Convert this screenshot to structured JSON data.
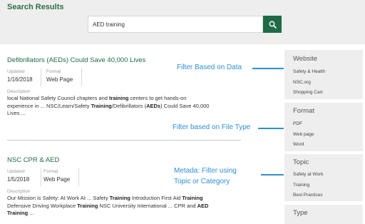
{
  "header": {
    "title": "Search Results",
    "search_value": "AED training"
  },
  "results": [
    {
      "title": "Defibrillators (AEDs) Could Save 40,000 Lives",
      "updated_label": "Updated",
      "updated_value": "1/16/2018",
      "format_label": "Format",
      "format_value": "Web Page",
      "description_label": "Description",
      "description_lines": [
        [
          "local National Safety Council chapters and ",
          {
            "b": "training"
          },
          " centers to get hands-on"
        ],
        [
          "experience in ... NSC/Learn/Safety ",
          {
            "b": "Training"
          },
          "/Defibrillators (",
          {
            "b": "AEDs"
          },
          ") Could Save 40,000"
        ],
        [
          "Lives ..."
        ]
      ]
    },
    {
      "title": "NSC CPR & AED",
      "updated_label": "Updated",
      "updated_value": "1/5/2018",
      "format_label": "Format",
      "format_value": "Web Page",
      "description_label": "Description",
      "description_lines": [
        [
          "Our Mission is Safety: At Work At ... Safety ",
          {
            "b": "Training"
          },
          " Introduction First Aid ",
          {
            "b": "Training"
          }
        ],
        [
          "Defensive Driving Workplace ",
          {
            "b": "Training"
          },
          " NSC University International ... CPR and ",
          {
            "b": "AED"
          }
        ],
        [
          {
            "b": "Training"
          },
          " ..."
        ]
      ]
    }
  ],
  "facets": [
    {
      "title": "Website",
      "items": [
        "Safety & Health",
        "NSC.org",
        "Shopping Cart"
      ]
    },
    {
      "title": "Format",
      "items": [
        "PDF",
        "Web page",
        "Word"
      ]
    },
    {
      "title": "Topic",
      "items": [
        "Safety at Work",
        "Training",
        "Best Practices"
      ]
    },
    {
      "title": "Type",
      "items": []
    }
  ],
  "annotations": [
    "Filter Based on Data",
    "Filter based on File Type",
    "Metada: Filter using",
    "Topic or Category"
  ],
  "colors": {
    "brand_green": "#1f6b45",
    "annotation_blue": "#2e8fd6",
    "panel_gray": "#eeeeee"
  },
  "icons": {
    "search_button": "search-icon"
  }
}
